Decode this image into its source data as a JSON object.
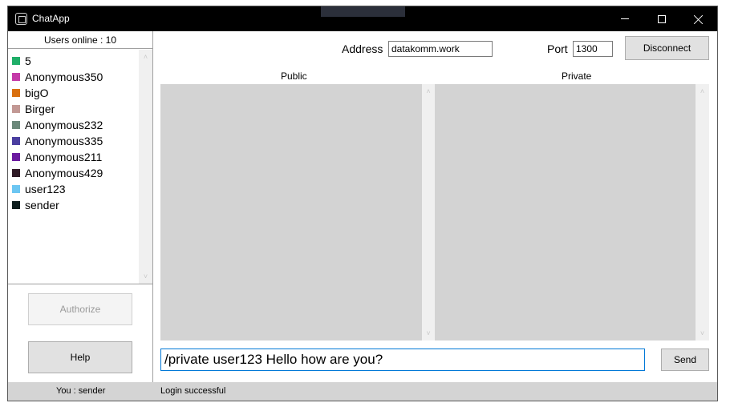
{
  "window": {
    "title": "ChatApp"
  },
  "users": {
    "header": "Users online : 10",
    "items": [
      {
        "name": "5",
        "color": "#1fae68"
      },
      {
        "name": "Anonymous350",
        "color": "#c43aa8"
      },
      {
        "name": "bigO",
        "color": "#d9700f"
      },
      {
        "name": "Birger",
        "color": "#c29894"
      },
      {
        "name": "Anonymous232",
        "color": "#6b887a"
      },
      {
        "name": "Anonymous335",
        "color": "#4a3ea0"
      },
      {
        "name": "Anonymous211",
        "color": "#6b1aa0"
      },
      {
        "name": "Anonymous429",
        "color": "#301a26"
      },
      {
        "name": "user123",
        "color": "#6cc6f2"
      },
      {
        "name": "sender",
        "color": "#0f1e1e"
      }
    ]
  },
  "buttons": {
    "authorize": "Authorize",
    "help": "Help",
    "disconnect": "Disconnect",
    "send": "Send"
  },
  "connection": {
    "address_label": "Address",
    "address_value": "datakomm.work",
    "port_label": "Port",
    "port_value": "1300"
  },
  "panes": {
    "public_label": "Public",
    "private_label": "Private"
  },
  "message": {
    "value": "/private user123 Hello how are you?"
  },
  "status": {
    "you": "You : sender",
    "message": "Login successful"
  }
}
